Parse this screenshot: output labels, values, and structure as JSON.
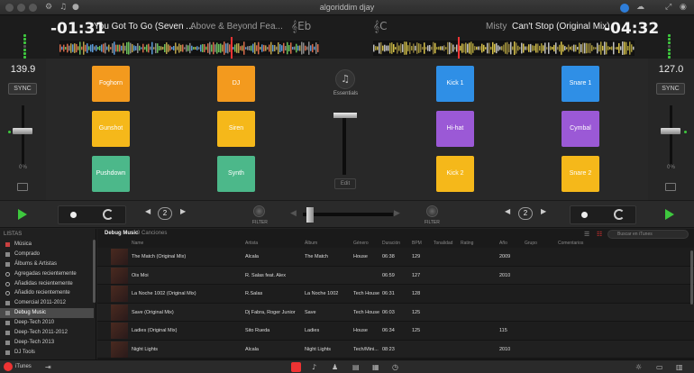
{
  "titlebar": {
    "title": "djay",
    "title_brand": "algoriddim"
  },
  "deck_left": {
    "time": "-01:31",
    "title": "You Got To Go (Seven ...",
    "artist": "Above & Beyond Fea...",
    "key": "Eb",
    "bpm": "139.9",
    "sync_label": "SYNC",
    "pitch_percent": "0%",
    "play_position": 0.55
  },
  "deck_right": {
    "time": "-04:32",
    "title": "Can't Stop (Original Mix)",
    "artist": "Misty",
    "key": "C",
    "bpm": "127.0",
    "sync_label": "SYNC",
    "pitch_percent": "0%",
    "play_position": 0.3
  },
  "pads_left": [
    {
      "label": "Foghorn",
      "color": "#f39a1e"
    },
    {
      "label": "DJ",
      "color": "#f39a1e"
    },
    {
      "label": "Gunshot",
      "color": "#f5b81a"
    },
    {
      "label": "Siren",
      "color": "#f5b81a"
    },
    {
      "label": "Pushdown",
      "color": "#4cb88a"
    },
    {
      "label": "Synth",
      "color": "#4cb88a"
    }
  ],
  "pads_right": [
    {
      "label": "Kick 1",
      "color": "#2f8fe6"
    },
    {
      "label": "Snare 1",
      "color": "#2f8fe6"
    },
    {
      "label": "Hi-hat",
      "color": "#9b59d6"
    },
    {
      "label": "Cymbal",
      "color": "#9b59d6"
    },
    {
      "label": "Kick 2",
      "color": "#f5b81a"
    },
    {
      "label": "Snare 2",
      "color": "#f5b81a"
    }
  ],
  "center": {
    "essentials_label": "Essentials",
    "edit_label": "Edit"
  },
  "transport": {
    "beats_left": "2",
    "beats_right": "2",
    "filter_label": "FILTER",
    "crossfader_position": 0.04
  },
  "sidebar": {
    "header": "LISTAS",
    "items": [
      {
        "label": "Música",
        "icon": "music-note-icon"
      },
      {
        "label": "Comprado",
        "icon": "playlist-icon"
      },
      {
        "label": "Álbums & Artistas",
        "icon": "album-icon"
      },
      {
        "label": "Agregadas recientemente",
        "icon": "smart-playlist-icon"
      },
      {
        "label": "Añadidas recientemente",
        "icon": "smart-playlist-icon"
      },
      {
        "label": "Añadido recientemente",
        "icon": "smart-playlist-icon"
      },
      {
        "label": "Comercial 2011-2012",
        "icon": "playlist-icon"
      },
      {
        "label": "Debug Music",
        "icon": "playlist-icon",
        "selected": true
      },
      {
        "label": "Deep-Tech 2010",
        "icon": "playlist-icon"
      },
      {
        "label": "Deep-Tech 2011-2012",
        "icon": "playlist-icon"
      },
      {
        "label": "Deep-Tech 2013",
        "icon": "playlist-icon"
      },
      {
        "label": "DJ Tools",
        "icon": "playlist-icon"
      }
    ]
  },
  "library": {
    "source": "Debug Music",
    "count": "9 Canciones",
    "search_placeholder": "Buscar en iTunes",
    "columns": [
      "Name",
      "Artista",
      "Álbum",
      "Género",
      "Duración",
      "BPM",
      "Tonalidad",
      "Rating",
      "Año",
      "Grupo",
      "Comentarios"
    ],
    "rows": [
      {
        "name": "The Match (Original Mix)",
        "artist": "Alcala",
        "album": "The Match",
        "genre": "House",
        "duration": "06:38",
        "bpm": "129",
        "key": "",
        "rating": "",
        "year": "2009"
      },
      {
        "name": "Ois Moi",
        "artist": "R. Salas feat. Alex",
        "album": "",
        "genre": "",
        "duration": "06:59",
        "bpm": "127",
        "key": "",
        "rating": "",
        "year": "2010"
      },
      {
        "name": "La Noche 1002 (Original Mix)",
        "artist": "R.Salas",
        "album": "La Noche 1002",
        "genre": "Tech House",
        "duration": "06:31",
        "bpm": "128",
        "key": "",
        "rating": "",
        "year": ""
      },
      {
        "name": "Save (Original Mix)",
        "artist": "Dj Fabra, Roger Junior",
        "album": "Save",
        "genre": "Tech House",
        "duration": "06:03",
        "bpm": "125",
        "key": "",
        "rating": "",
        "year": ""
      },
      {
        "name": "Ladies (Original Mix)",
        "artist": "Sito Rueda",
        "album": "Ladies",
        "genre": "House",
        "duration": "06:34",
        "bpm": "125",
        "key": "",
        "rating": "",
        "year": "115"
      },
      {
        "name": "Night Lights",
        "artist": "Alcala",
        "album": "Night Lights",
        "genre": "Tech/Mini...",
        "duration": "08:23",
        "bpm": "",
        "key": "",
        "rating": "",
        "year": "2010"
      }
    ]
  },
  "footer": {
    "source_label": "iTunes"
  }
}
